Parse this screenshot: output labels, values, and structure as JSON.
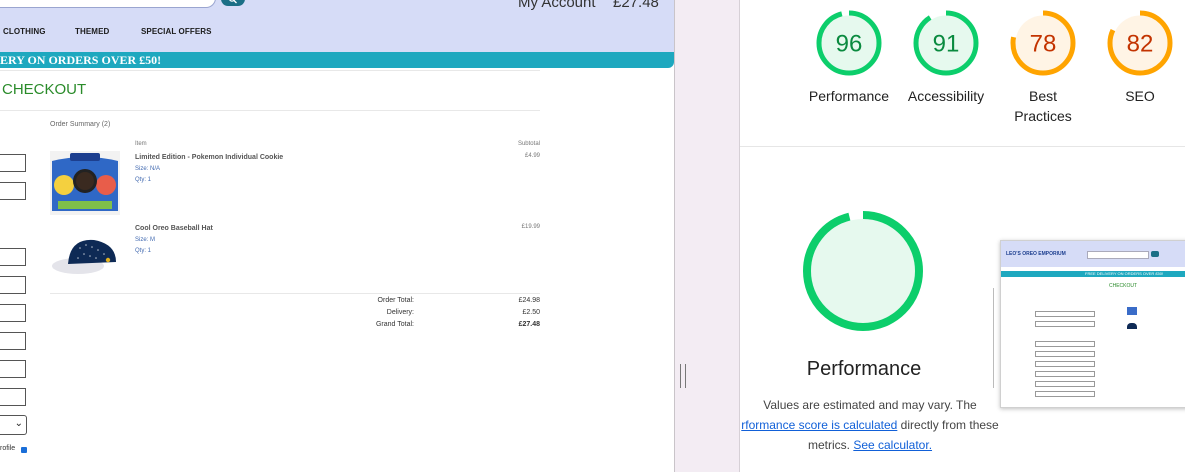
{
  "site": {
    "account_label": "My Account",
    "cart_total": "£27.48",
    "nav": [
      "CLOTHING",
      "THEMED",
      "SPECIAL OFFERS"
    ],
    "banner": "ERY ON ORDERS OVER £50!",
    "checkout_title": "CHECKOUT",
    "save_profile_label": "rofile",
    "save_profile_checked": true,
    "order_summary": {
      "title": "Order Summary (2)",
      "col_item": "Item",
      "col_subtotal": "Subtotal",
      "items": [
        {
          "name": "Limited Edition - Pokemon Individual Cookie",
          "size": "Size: N/A",
          "qty": "Qty: 1",
          "price": "£4.99"
        },
        {
          "name": "Cool Oreo Baseball Hat",
          "size": "Size: M",
          "qty": "Qty: 1",
          "price": "£19.99"
        }
      ],
      "totals": [
        {
          "label": "Order Total:",
          "value": "£24.98"
        },
        {
          "label": "Delivery:",
          "value": "£2.50"
        },
        {
          "label": "Grand Total:",
          "value": "£27.48"
        }
      ]
    }
  },
  "report": {
    "gauges": [
      {
        "score": "96",
        "label": "Performance",
        "color": "#0cce6b",
        "fill": "#e6f9ee",
        "text_color": "#0a8a3f",
        "fraction": 0.96
      },
      {
        "score": "91",
        "label": "Accessibility",
        "color": "#0cce6b",
        "fill": "#e6f9ee",
        "text_color": "#0a8a3f",
        "fraction": 0.91
      },
      {
        "score": "78",
        "label": "Best\nPractices",
        "color": "#ffa400",
        "fill": "#fff4e5",
        "text_color": "#c33300",
        "fraction": 0.78
      },
      {
        "score": "82",
        "label": "SEO",
        "color": "#ffa400",
        "fill": "#fff4e5",
        "text_color": "#c33300",
        "fraction": 0.82
      }
    ],
    "big_gauge": {
      "label": "Performance",
      "color": "#0cce6b",
      "fill": "#e6f9ee",
      "fraction": 0.96
    },
    "note": {
      "prefix": "Values are estimated and may vary. The",
      "link1": "rformance score is calculated",
      "middle": " directly from these",
      "line3_prefix": "metrics. ",
      "link2": "See calculator."
    },
    "thumbnail": {
      "brand": "LEO'S OREO EMPORIUM",
      "banner": "FREE DELIVERY ON ORDERS OVER £50!",
      "checkout": "CHECKOUT"
    }
  }
}
